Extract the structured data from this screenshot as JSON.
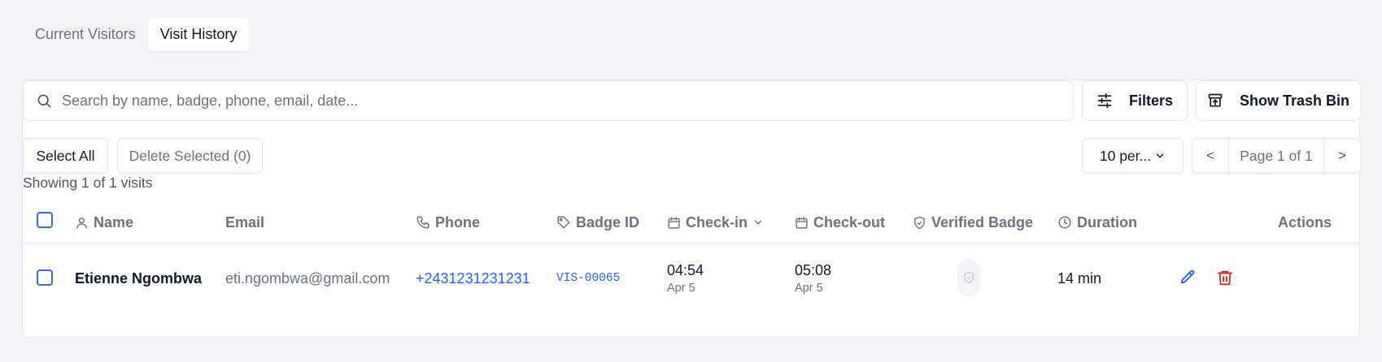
{
  "tabs": [
    {
      "label": "Current Visitors",
      "active": false
    },
    {
      "label": "Visit History",
      "active": true
    }
  ],
  "search": {
    "placeholder": "Search by name, badge, phone, email, date...",
    "value": ""
  },
  "toolbar": {
    "filters_label": "Filters",
    "trash_label": "Show Trash Bin"
  },
  "selection": {
    "select_all_label": "Select All",
    "delete_selected_label": "Delete Selected (0)"
  },
  "pagination": {
    "per_page_label": "10 per...",
    "prev": "<",
    "page_label": "Page 1 of 1",
    "next": ">"
  },
  "summary": "Showing 1 of 1 visits",
  "table": {
    "columns": {
      "name": "Name",
      "email": "Email",
      "phone": "Phone",
      "badge_id": "Badge ID",
      "check_in": "Check-in",
      "check_out": "Check-out",
      "verified": "Verified Badge",
      "duration": "Duration",
      "actions": "Actions"
    },
    "rows": [
      {
        "name": "Etienne Ngombwa",
        "email": "eti.ngombwa@gmail.com",
        "phone": "+2431231231231",
        "badge_id": "VIS-00065",
        "check_in_time": "04:54",
        "check_in_date": "Apr 5",
        "check_out_time": "05:08",
        "check_out_date": "Apr 5",
        "verified": false,
        "duration": "14 min"
      }
    ]
  },
  "icons": [
    "search-icon",
    "sliders-icon",
    "archive-icon",
    "chevron-down-icon",
    "user-icon",
    "phone-icon",
    "tag-icon",
    "calendar-icon",
    "shield-check-icon",
    "clock-icon",
    "pencil-icon",
    "trash-icon"
  ],
  "colors": {
    "accent_blue": "#2563eb",
    "danger_red": "#dc2626",
    "muted_text": "#6b7280",
    "background": "#f3f4f6"
  }
}
